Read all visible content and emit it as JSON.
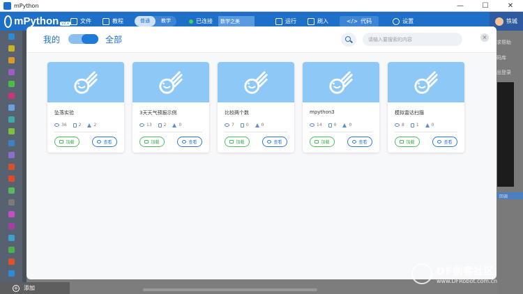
{
  "window": {
    "title": "mPython",
    "minimize": "—",
    "maximize": "☐",
    "close": "✕"
  },
  "toolbar": {
    "logo": "mPython",
    "logo_version": "v2.x",
    "file": "文件",
    "tutorial": "教程",
    "mode_normal": "普通",
    "mode_teach": "教学",
    "connection": "已连接",
    "project_name": "数学之美",
    "run": "运行",
    "flash": "刷入",
    "code": "代码",
    "settings": "设置",
    "username": "铁城"
  },
  "right_panel": {
    "help": "求帮助",
    "library": "码库",
    "logout": "出登录",
    "toggle_label": "回调"
  },
  "bottom": {
    "add": "添加"
  },
  "modal": {
    "tab_mine": "我的",
    "tab_all": "全部",
    "toggle_selected": "全部",
    "search_placeholder": "请输入要搜索的内容",
    "close": "×",
    "add_label": "加载",
    "view_label": "查看",
    "cards": [
      {
        "title": "坠落实验",
        "views": "36",
        "likes": "2",
        "stars": "2"
      },
      {
        "title": "3天天气预报示例",
        "views": "13",
        "likes": "2",
        "stars": "0"
      },
      {
        "title": "比较两个数",
        "views": "7",
        "likes": "0",
        "stars": "0"
      },
      {
        "title": "mpython3",
        "views": "14",
        "likes": "0",
        "stars": "0"
      },
      {
        "title": "模拟雷达扫描",
        "views": "8",
        "likes": "1",
        "stars": "0"
      }
    ]
  },
  "watermark": {
    "title": "DF创客社区",
    "url": "www.DFRobot.com.cn"
  },
  "colors": {
    "brand": "#1e6fc7",
    "thumb": "#8ec8f6",
    "add_green": "#4cbf5c"
  }
}
